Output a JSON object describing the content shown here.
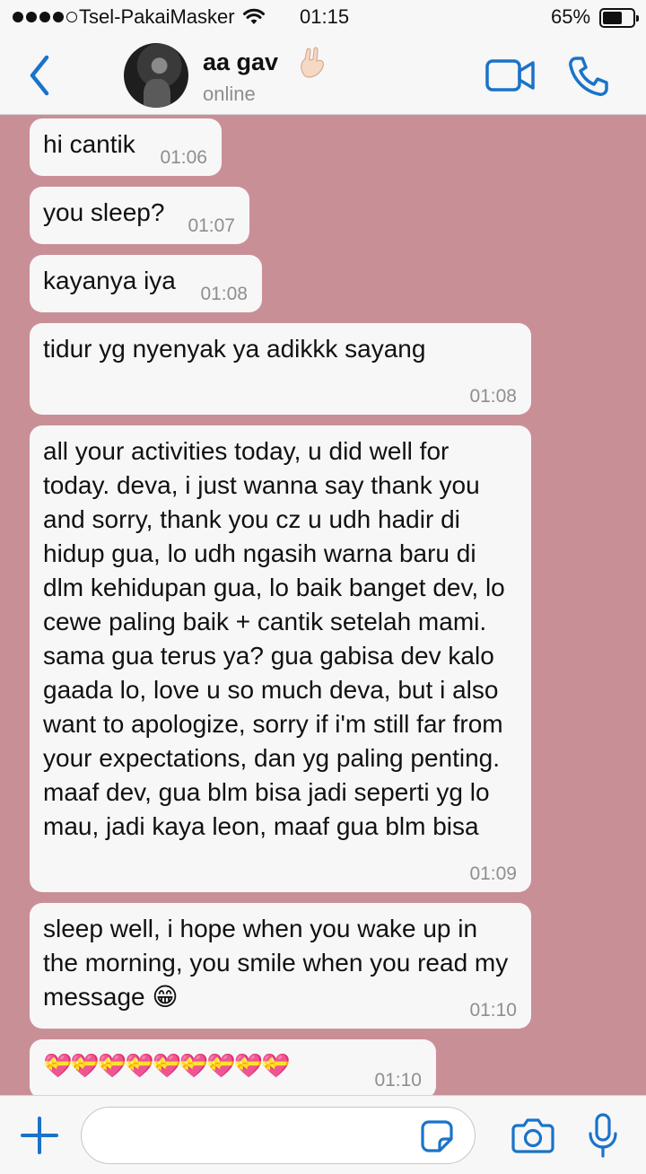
{
  "status_bar": {
    "carrier": "Tsel-PakaiMasker",
    "time": "01:15",
    "battery_pct": "65%",
    "battery_level": 0.65
  },
  "header": {
    "contact_name": "aa gav",
    "contact_status": "online",
    "name_emoji": "🤟🏻"
  },
  "messages": [
    {
      "text": "hi cantik",
      "time": "01:06"
    },
    {
      "text": "you sleep?",
      "time": "01:07"
    },
    {
      "text": "kayanya iya",
      "time": "01:08"
    },
    {
      "text": "tidur yg nyenyak ya adikkk sayang",
      "time": "01:08"
    },
    {
      "text": "all your activities today, u did well for today. deva, i just wanna say thank you and sorry, thank you cz u udh hadir di hidup gua, lo udh ngasih warna baru di dlm kehidupan gua, lo baik banget dev, lo cewe paling baik + cantik setelah mami. sama gua terus ya? gua gabisa dev kalo gaada lo, love u so much deva, but i also want to apologize, sorry if i'm still far from your expectations, dan yg paling penting. maaf dev, gua blm bisa jadi seperti yg lo mau, jadi kaya leon, maaf gua blm bisa",
      "time": "01:09"
    },
    {
      "text": "sleep well, i hope when you wake up in the morning, you smile when you read my message 😁",
      "time": "01:10"
    },
    {
      "text": "💝💝💝💝💝💝💝💝💝",
      "time": "01:10"
    }
  ],
  "colors": {
    "accent": "#1a73c9",
    "chat_background": "#c98f97",
    "bubble": "#f7f7f7",
    "bar": "#f7f7f7"
  },
  "icons": [
    "back-chevron-icon",
    "video-call-icon",
    "phone-icon",
    "plus-icon",
    "sticker-icon",
    "camera-icon",
    "microphone-icon",
    "wifi-icon"
  ]
}
